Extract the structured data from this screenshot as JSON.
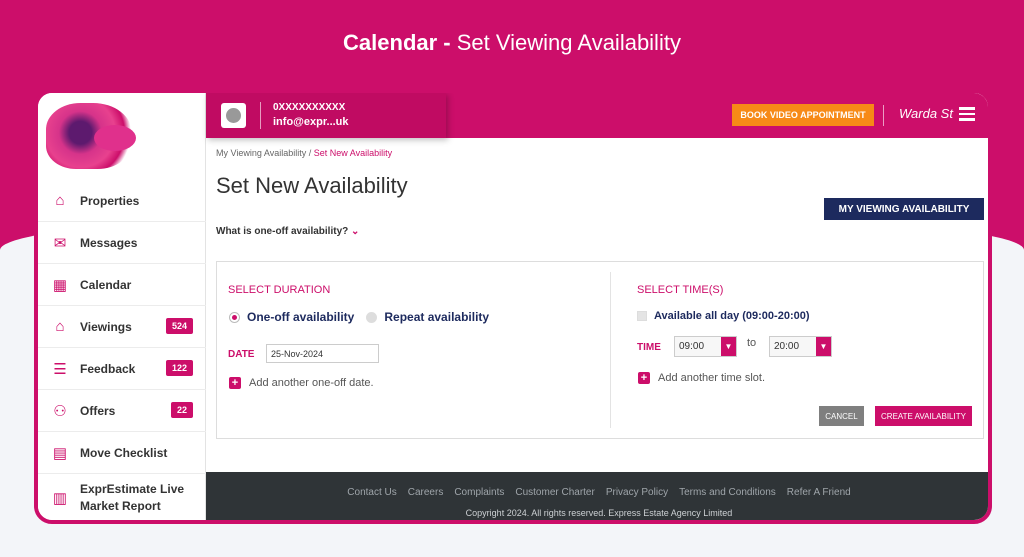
{
  "headline": {
    "bold": "Calendar -",
    "rest": " Set Viewing Availability"
  },
  "header": {
    "user_line1": "0XXXXXXXXXX",
    "user_line2": "info@expr...uk",
    "book_button": "BOOK VIDEO APPOINTMENT",
    "user_name": "Warda St"
  },
  "sidebar": {
    "items": [
      {
        "label": "Properties",
        "icon": "house-icon"
      },
      {
        "label": "Messages",
        "icon": "chat-icon"
      },
      {
        "label": "Calendar",
        "icon": "calendar-icon"
      },
      {
        "label": "Viewings",
        "icon": "viewings-icon",
        "count": "524"
      },
      {
        "label": "Feedback",
        "icon": "feedback-icon",
        "count": "122"
      },
      {
        "label": "Offers",
        "icon": "offers-icon",
        "count": "22"
      },
      {
        "label": "Move Checklist",
        "icon": "checklist-icon"
      }
    ],
    "report_line1": "ExprEstimate Live",
    "report_line2": "Market Report"
  },
  "breadcrumb": {
    "parent": "My Viewing Availability",
    "separator": "/",
    "current": "Set New Availability"
  },
  "page_title": "Set New Availability",
  "my_viewing_button": "MY VIEWING AVAILABILITY",
  "what_is": "What is one-off availability?",
  "duration": {
    "title": "SELECT DURATION",
    "option_oneoff": "One-off availability",
    "option_repeat": "Repeat availability",
    "date_label": "DATE",
    "date_value": "25-Nov-2024",
    "add_date": "Add another one-off date."
  },
  "times": {
    "title": "SELECT TIME(S)",
    "all_day": "Available all day (09:00-20:00)",
    "time_label": "TIME",
    "from": "09:00",
    "to_label": "to",
    "to": "20:00",
    "add_slot": "Add another time slot."
  },
  "buttons": {
    "cancel": "CANCEL",
    "create": "CREATE AVAILABILITY"
  },
  "footer": {
    "links": [
      "Contact Us",
      "Careers",
      "Complaints",
      "Customer Charter",
      "Privacy Policy",
      "Terms and Conditions",
      "Refer A Friend"
    ],
    "copyright": "Copyright 2024. All rights reserved. Express Estate Agency Limited"
  },
  "colors": {
    "brand": "#cc0e6a",
    "navy": "#1d2a5e",
    "orange": "#f78a17",
    "footer": "#2f3437"
  }
}
